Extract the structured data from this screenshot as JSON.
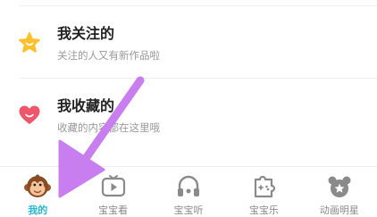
{
  "list": [
    {
      "title": "我关注的",
      "subtitle": "关注的人又有新作品啦",
      "icon": "star-icon",
      "icon_color": "#ffc02e"
    },
    {
      "title": "我收藏的",
      "subtitle": "收藏的内容都在这里哦",
      "icon": "heart-icon",
      "icon_color": "#f0566a"
    }
  ],
  "tabbar": {
    "active": 0,
    "active_color": "#27b8cf",
    "inactive_color": "#8a8a8a",
    "tabs": [
      {
        "label": "我的",
        "icon": "monkey-avatar-icon"
      },
      {
        "label": "宝宝看",
        "icon": "video-play-icon"
      },
      {
        "label": "宝宝听",
        "icon": "headphones-icon"
      },
      {
        "label": "宝宝乐",
        "icon": "puzzle-game-icon"
      },
      {
        "label": "动画明星",
        "icon": "bear-head-icon"
      }
    ]
  },
  "overlay": {
    "arrow_color": "#c97ef0",
    "arrow_icon": "annotation-arrow-icon"
  }
}
